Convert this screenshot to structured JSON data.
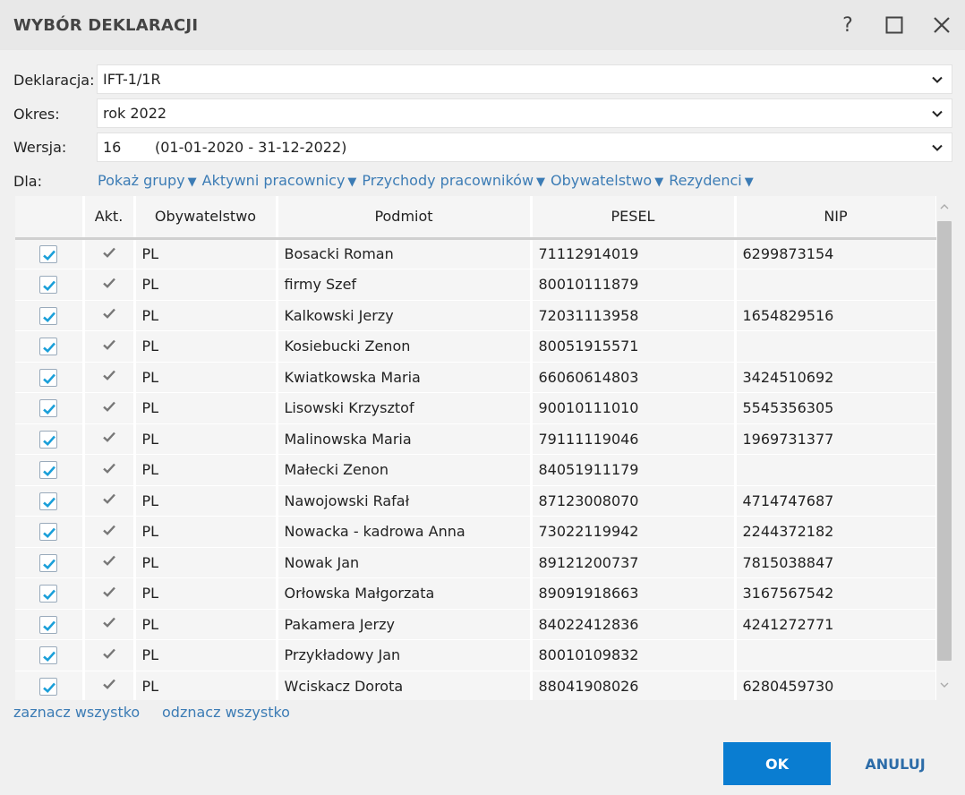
{
  "window": {
    "title": "WYBÓR DEKLARACJI",
    "help_label": "?"
  },
  "form": {
    "deklaracja": {
      "label": "Deklaracja:",
      "value": "IFT-1/1R"
    },
    "okres": {
      "label": "Okres:",
      "value": "rok 2022"
    },
    "wersja": {
      "label": "Wersja:",
      "number": "16",
      "range": "(01-01-2020 - 31-12-2022)"
    },
    "dla": {
      "label": "Dla:"
    }
  },
  "filters": [
    {
      "label": "Pokaż grupy",
      "icon": "triangle-down-icon"
    },
    {
      "label": "Aktywni pracownicy",
      "icon": "triangle-down-icon"
    },
    {
      "label": "Przychody pracowników",
      "icon": "triangle-down-icon"
    },
    {
      "label": "Obywatelstwo",
      "icon": "triangle-down-icon"
    },
    {
      "label": "Rezydenci",
      "icon": "triangle-down-icon"
    }
  ],
  "table": {
    "columns": [
      "",
      "Akt.",
      "Obywatelstwo",
      "Podmiot",
      "PESEL",
      "NIP"
    ],
    "rows": [
      {
        "checked": true,
        "akt": true,
        "obywatelstwo": "PL",
        "podmiot": "Bosacki Roman",
        "pesel": "71112914019",
        "nip": "6299873154"
      },
      {
        "checked": true,
        "akt": true,
        "obywatelstwo": "PL",
        "podmiot": "firmy Szef",
        "pesel": "80010111879",
        "nip": ""
      },
      {
        "checked": true,
        "akt": true,
        "obywatelstwo": "PL",
        "podmiot": "Kalkowski Jerzy",
        "pesel": "72031113958",
        "nip": "1654829516"
      },
      {
        "checked": true,
        "akt": true,
        "obywatelstwo": "PL",
        "podmiot": "Kosiebucki Zenon",
        "pesel": "80051915571",
        "nip": ""
      },
      {
        "checked": true,
        "akt": true,
        "obywatelstwo": "PL",
        "podmiot": "Kwiatkowska Maria",
        "pesel": "66060614803",
        "nip": "3424510692"
      },
      {
        "checked": true,
        "akt": true,
        "obywatelstwo": "PL",
        "podmiot": "Lisowski Krzysztof",
        "pesel": "90010111010",
        "nip": "5545356305"
      },
      {
        "checked": true,
        "akt": true,
        "obywatelstwo": "PL",
        "podmiot": "Malinowska Maria",
        "pesel": "79111119046",
        "nip": "1969731377"
      },
      {
        "checked": true,
        "akt": true,
        "obywatelstwo": "PL",
        "podmiot": "Małecki Zenon",
        "pesel": "84051911179",
        "nip": ""
      },
      {
        "checked": true,
        "akt": true,
        "obywatelstwo": "PL",
        "podmiot": "Nawojowski Rafał",
        "pesel": "87123008070",
        "nip": "4714747687"
      },
      {
        "checked": true,
        "akt": true,
        "obywatelstwo": "PL",
        "podmiot": "Nowacka - kadrowa Anna",
        "pesel": "73022119942",
        "nip": "2244372182"
      },
      {
        "checked": true,
        "akt": true,
        "obywatelstwo": "PL",
        "podmiot": "Nowak Jan",
        "pesel": "89121200737",
        "nip": "7815038847"
      },
      {
        "checked": true,
        "akt": true,
        "obywatelstwo": "PL",
        "podmiot": "Orłowska Małgorzata",
        "pesel": "89091918663",
        "nip": "3167567542"
      },
      {
        "checked": true,
        "akt": true,
        "obywatelstwo": "PL",
        "podmiot": "Pakamera Jerzy",
        "pesel": "84022412836",
        "nip": "4241272771"
      },
      {
        "checked": true,
        "akt": true,
        "obywatelstwo": "PL",
        "podmiot": "Przykładowy Jan",
        "pesel": "80010109832",
        "nip": ""
      },
      {
        "checked": true,
        "akt": true,
        "obywatelstwo": "PL",
        "podmiot": "Wciskacz Dorota",
        "pesel": "88041908026",
        "nip": "6280459730"
      }
    ]
  },
  "links": {
    "select_all": "zaznacz wszystko",
    "deselect_all": "odznacz wszystko"
  },
  "buttons": {
    "ok": "OK",
    "cancel": "ANULUJ"
  },
  "colors": {
    "accent": "#0a7dd1",
    "link": "#3c7cb5",
    "check": "#1a9fd9"
  }
}
